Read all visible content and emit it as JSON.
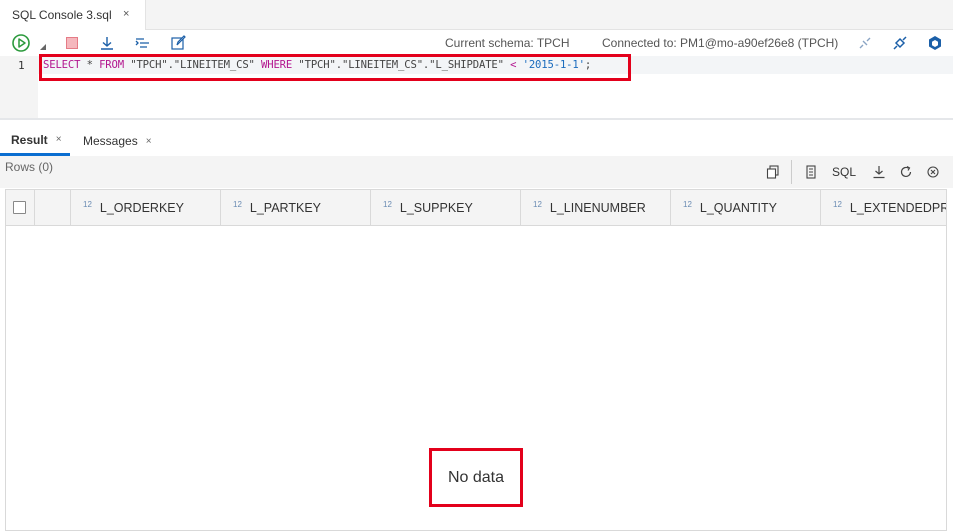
{
  "tab": {
    "title": "SQL Console 3.sql",
    "close": "×"
  },
  "toolbar": {
    "schema": "Current schema: TPCH",
    "connection": "Connected to: PM1@mo-a90ef26e8 (TPCH)"
  },
  "editor": {
    "line_number": "1",
    "tokens": {
      "select": "SELECT",
      "star": " * ",
      "from": "FROM",
      "table": " \"TPCH\".\"LINEITEM_CS\" ",
      "where": "WHERE",
      "column": " \"TPCH\".\"LINEITEM_CS\".\"L_SHIPDATE\" ",
      "lt": "<",
      "value": " '2015-1-1'",
      "semi": ";"
    }
  },
  "result_tabs": [
    {
      "label": "Result",
      "close": "×"
    },
    {
      "label": "Messages",
      "close": "×"
    }
  ],
  "result": {
    "rows_label": "Rows (0)",
    "sql_button": "SQL",
    "columns": [
      {
        "type": "12",
        "name": "L_ORDERKEY"
      },
      {
        "type": "12",
        "name": "L_PARTKEY"
      },
      {
        "type": "12",
        "name": "L_SUPPKEY"
      },
      {
        "type": "12",
        "name": "L_LINENUMBER"
      },
      {
        "type": "12",
        "name": "L_QUANTITY"
      },
      {
        "type": "12",
        "name": "L_EXTENDEDPRICE"
      }
    ],
    "empty_message": "No data"
  },
  "colors": {
    "accent": "#0a6ed1",
    "highlight": "#e3001b",
    "keyword": "#b3168f"
  }
}
